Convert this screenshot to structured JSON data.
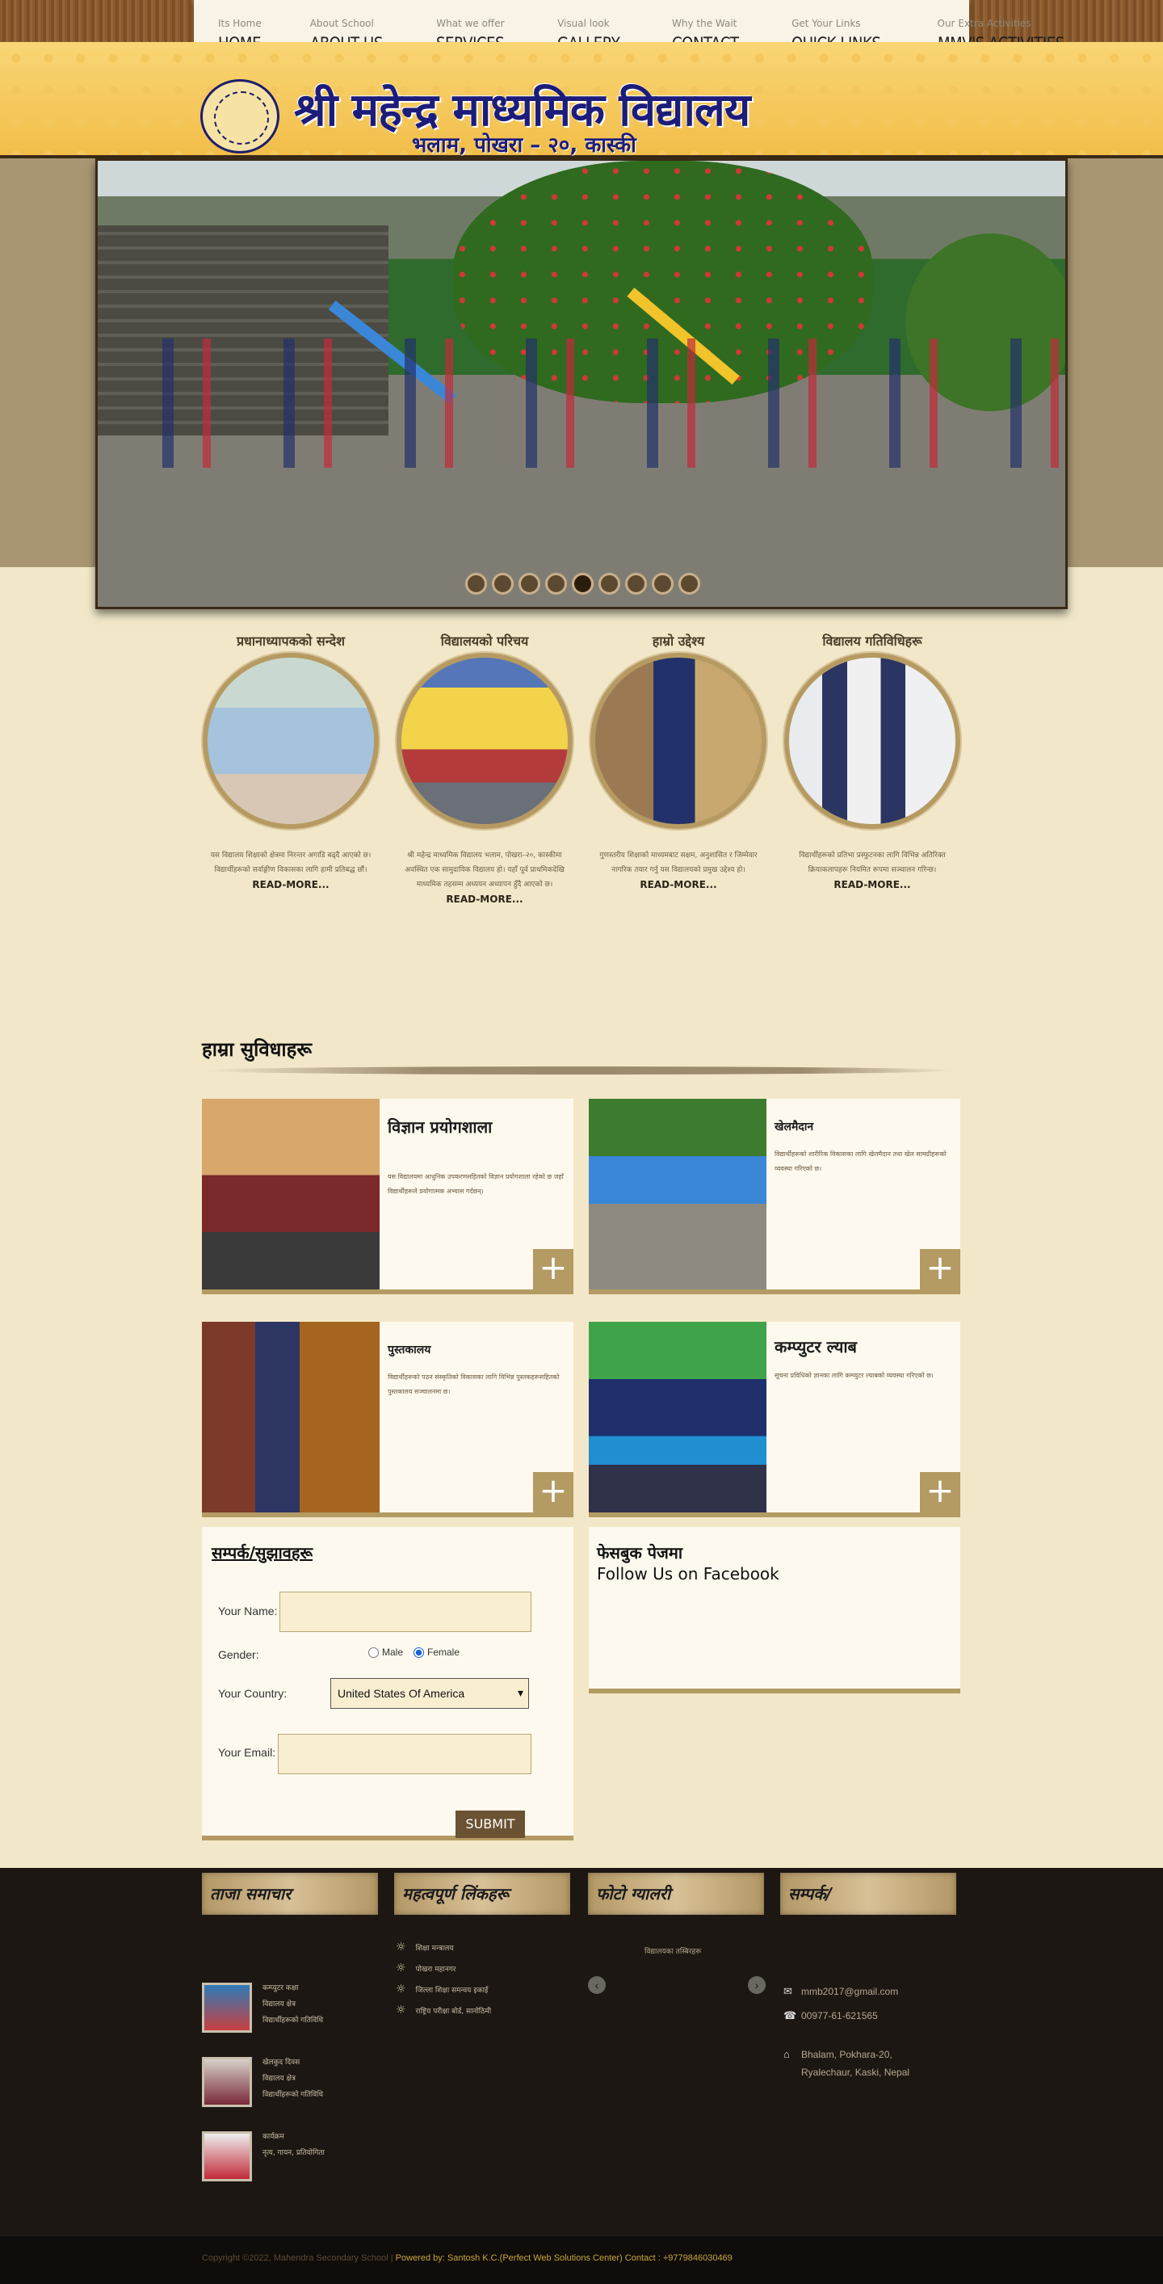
{
  "nav": [
    {
      "sub": "Its Home",
      "main": "HOME"
    },
    {
      "sub": "About School",
      "main": "ABOUT US"
    },
    {
      "sub": "What we offer",
      "main": "SERVICES"
    },
    {
      "sub": "Visual look",
      "main": "GALLERY"
    },
    {
      "sub": "Why the Wait",
      "main": "CONTACT"
    },
    {
      "sub": "Get Your Links",
      "main": "QUICK LINKS"
    },
    {
      "sub": "Our Extra Activities",
      "main": "MMV'S ACTIVITIES"
    }
  ],
  "banner": {
    "title": "श्री महेन्द्र माध्यमिक विद्यालय",
    "subtitle": "भलाम, पोखरा – २०, कास्की"
  },
  "slider": {
    "dot_count": 9,
    "active_dot": 5
  },
  "features": [
    {
      "title": "प्रधानाध्यापकको सन्देश",
      "text": "यस विद्यालय शिक्षाको क्षेत्रमा निरन्तर अगाडि बढ्दै आएको छ। विद्यार्थीहरूको सर्वाङ्गीण विकासका लागि हामी प्रतिबद्ध छौं।",
      "readmore": "READ-MORE..."
    },
    {
      "title": "विद्यालयको परिचय",
      "text": "श्री महेन्द्र माध्यमिक विद्यालय भलाम, पोखरा–२०, कास्कीमा अवस्थित एक सामुदायिक विद्यालय हो। यहाँ पूर्व प्राथमिकदेखि माध्यमिक तहसम्म अध्ययन अध्यापन हुँदै आएको छ।",
      "readmore": "READ-MORE..."
    },
    {
      "title": "हाम्रो उद्देश्य",
      "text": "गुणस्तरीय शिक्षाको माध्यमबाट सक्षम, अनुशासित र जिम्मेवार नागरिक तयार गर्नु यस विद्यालयको प्रमुख उद्देश्य हो।",
      "readmore": "READ-MORE..."
    },
    {
      "title": "विद्यालय गतिविधिहरू",
      "text": "विद्यार्थीहरूको प्रतिभा प्रस्फुटनका लागि विभिन्न अतिरिक्त क्रियाकलापहरू नियमित रूपमा सञ्चालन गरिन्छ।",
      "readmore": "READ-MORE..."
    }
  ],
  "section_heading": "हाम्रा सुविधाहरू",
  "cards": [
    {
      "title": "विज्ञान प्रयोगशाला",
      "text": "यस विद्यालयमा आधुनिक उपकरणसहितको विज्ञान प्रयोगशाला रहेको छ जहाँ विद्यार्थीहरूले प्रयोगात्मक अभ्यास गर्दछन्।",
      "plus": "+"
    },
    {
      "title": "खेलमैदान",
      "text": "विद्यार्थीहरूको शारीरिक विकासका लागि खेलमैदान तथा खेल सामग्रीहरूको व्यवस्था गरिएको छ।",
      "plus": "+"
    },
    {
      "title": "पुस्तकालय",
      "text": "विद्यार्थीहरूको पठन संस्कृतिको विकासका लागि विभिन्न पुस्तकहरूसहितको पुस्तकालय सञ्चालनमा छ।",
      "plus": "+"
    },
    {
      "title": "कम्प्युटर ल्याब",
      "text": "सूचना प्रविधिको ज्ञानका लागि कम्प्युटर ल्याबको व्यवस्था गरिएको छ।",
      "plus": "+"
    }
  ],
  "form": {
    "title": "सम्पर्क/सुझावहरू",
    "name_label": "Your Name:",
    "gender_label": "Gender:",
    "male": "Male",
    "female": "Female",
    "selected_gender": "Female",
    "country_label": "Your Country:",
    "country_value": "United States Of America",
    "email_label": "Your Email:",
    "submit": "SUBMIT"
  },
  "facebook": {
    "title": "फेसबुक पेजमा",
    "subtitle": "Follow Us on Facebook"
  },
  "footer": {
    "headings": [
      "ताजा समाचार",
      "महत्वपूर्ण लिंकहरू",
      "फोटो ग्यालरी",
      "सम्पर्क/"
    ],
    "news": [
      {
        "title": "कम्प्युटर कक्षा",
        "line1": "विद्यालय क्षेत्र",
        "line2": "विद्यार्थीहरूको गतिविधि"
      },
      {
        "title": "खेलकुद दिवस",
        "line1": "विद्यालय क्षेत्र",
        "line2": "विद्यार्थीहरूको गतिविधि"
      },
      {
        "title": "कार्यक्रम",
        "line1": "नृत्य, गायन, प्रतियोगिता",
        "line2": ""
      }
    ],
    "links": [
      "शिक्षा मन्त्रालय",
      "पोखरा महानगर",
      "जिल्ला शिक्षा समन्वय इकाई",
      "राष्ट्रिय परीक्षा बोर्ड, सानोठिमी"
    ],
    "gallery_caption": "विद्यालयका तस्बिरहरू",
    "contact": {
      "email": "mmb2017@gmail.com",
      "phone": "00977-61-621565",
      "address1": "Bhalam, Pokhara-20,",
      "address2": "Ryalechaur, Kaski, Nepal"
    }
  },
  "copyright": {
    "text": "Copyright ©2022, Mahendra Secondary School |",
    "powered": " Powered by: Santosh K.C.(Perfect Web Solutions Center) Contact : +9779846030469"
  }
}
